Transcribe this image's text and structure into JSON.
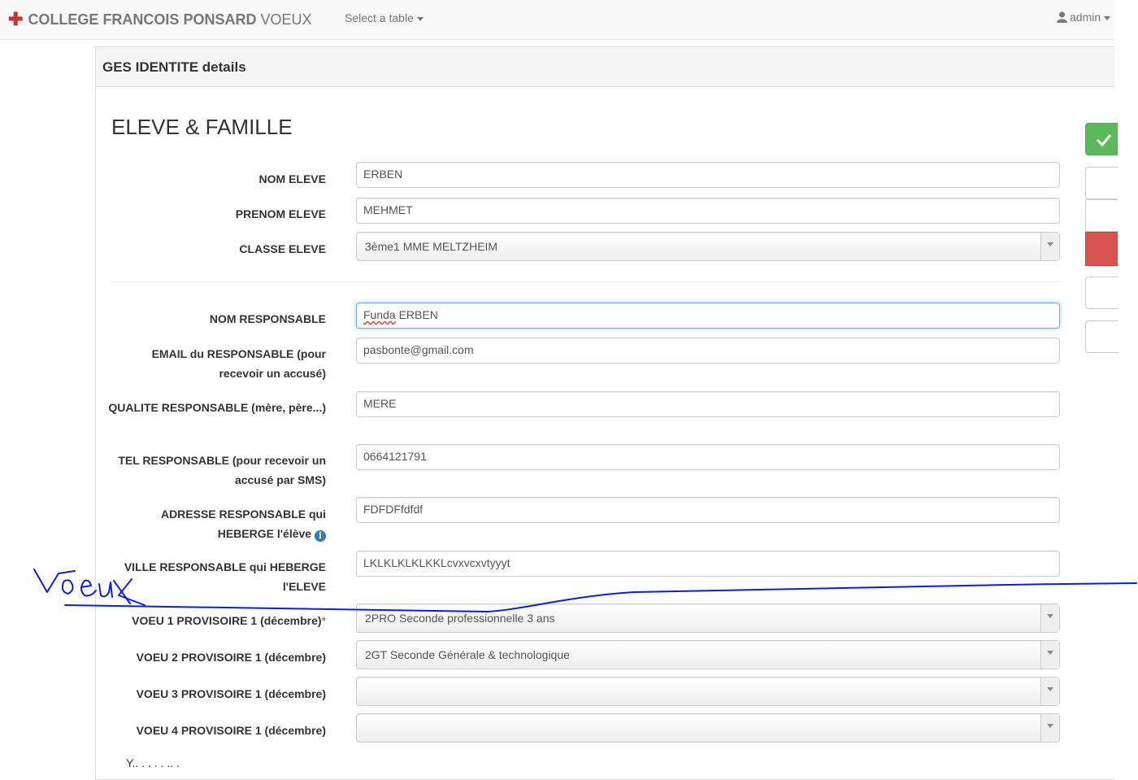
{
  "navbar": {
    "brand_bold": "COLLEGE FRANCOIS PONSARD",
    "brand_light": "VOEUX",
    "table_menu": "Select a table",
    "user": "admin"
  },
  "panel": {
    "title": "GES IDENTITE details",
    "section": "ELEVE & FAMILLE"
  },
  "form": {
    "nom_eleve": {
      "label": "NOM ELEVE",
      "value": "ERBEN"
    },
    "prenom_eleve": {
      "label": "PRENOM ELEVE",
      "value": "MEHMET"
    },
    "classe_eleve": {
      "label": "CLASSE ELEVE",
      "value": "3ème1 MME MELTZHEIM"
    },
    "nom_responsable": {
      "label": "NOM RESPONSABLE",
      "value_part1": "Funda",
      "value_part2": " ERBEN"
    },
    "email_responsable": {
      "label_bold": "EMAIL du RESPONSABLE",
      "label_rest": " (pour recevoir un accusé)",
      "value": "pasbonte@gmail.com"
    },
    "qualite_responsable": {
      "label_bold": "QUALITE RESPONSABLE",
      "label_rest": " (mère, père...)",
      "value": "MERE"
    },
    "tel_responsable": {
      "label_bold": "TEL RESPONSABLE",
      "label_rest": " (pour recevoir un accusé par SMS)",
      "value": "0664121791"
    },
    "adresse_responsable": {
      "label_bold": "ADRESSE RESPONSABLE",
      "label_rest": " qui HEBERGE l'élève",
      "value": "FDFDFfdfdf"
    },
    "ville_responsable": {
      "label_bold": "VILLE RESPONSABLE",
      "label_rest": " qui HEBERGE l'ELEVE",
      "value": "LKLKLKLKLKKLcvxvcxvtyyyt"
    },
    "voeu1": {
      "label": "VOEU 1 PROVISOIRE 1 (décembre)",
      "required_mark": "*",
      "value": "2PRO Seconde professionnelle 3 ans"
    },
    "voeu2": {
      "label": "VOEU 2 PROVISOIRE 1 (décembre)",
      "value": "2GT Seconde Générale & technologique"
    },
    "voeu3": {
      "label": "VOEU 3 PROVISOIRE 1 (décembre)",
      "value": ""
    },
    "voeu4": {
      "label": "VOEU 4 PROVISOIRE 1 (décembre)",
      "value": ""
    }
  },
  "annotation": {
    "handwritten_text": "Voeux",
    "color": "#0a1fd6"
  },
  "colors": {
    "success": "#5cb85c",
    "danger": "#d9534f",
    "info": "#337ab7",
    "brand_cross": "#c0392b"
  }
}
